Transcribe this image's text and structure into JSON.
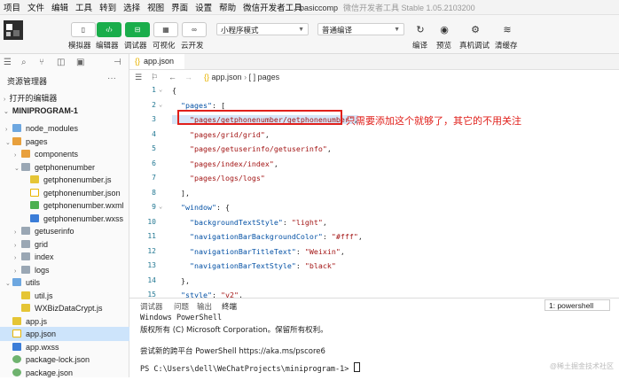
{
  "menubar": {
    "items": [
      "项目",
      "文件",
      "编辑",
      "工具",
      "转到",
      "选择",
      "视图",
      "界面",
      "设置",
      "帮助",
      "微信开发者工具"
    ],
    "project_name": "basiccomp",
    "app_title": "微信开发者工具 Stable 1.05.2103200"
  },
  "toolbar": {
    "simulator": "模拟器",
    "editor": "编辑器",
    "debugger": "调试器",
    "visual": "可视化",
    "cloud": "云开发",
    "mode_select": "小程序模式",
    "compile_select": "普通编译",
    "compile": "编译",
    "preview": "预览",
    "real_debug": "真机调试",
    "clear_cache": "清缓存"
  },
  "sidebar": {
    "resource_manager": "资源管理器",
    "open_editors": "打开的编辑器",
    "root": "MINIPROGRAM-1",
    "tree": [
      {
        "label": "node_modules",
        "depth": 1,
        "kind": "folder-blue",
        "arrow": "›"
      },
      {
        "label": "pages",
        "depth": 1,
        "kind": "folder-orange",
        "arrow": "⌄"
      },
      {
        "label": "components",
        "depth": 2,
        "kind": "folder-orange",
        "arrow": "›"
      },
      {
        "label": "getphonenumber",
        "depth": 2,
        "kind": "folder-gray",
        "arrow": "⌄"
      },
      {
        "label": "getphonenumber.js",
        "depth": 3,
        "kind": "js",
        "arrow": ""
      },
      {
        "label": "getphonenumber.json",
        "depth": 3,
        "kind": "json",
        "arrow": ""
      },
      {
        "label": "getphonenumber.wxml",
        "depth": 3,
        "kind": "wxml",
        "arrow": ""
      },
      {
        "label": "getphonenumber.wxss",
        "depth": 3,
        "kind": "wxss",
        "arrow": ""
      },
      {
        "label": "getuserinfo",
        "depth": 2,
        "kind": "folder-gray",
        "arrow": "›"
      },
      {
        "label": "grid",
        "depth": 2,
        "kind": "folder-gray",
        "arrow": "›"
      },
      {
        "label": "index",
        "depth": 2,
        "kind": "folder-gray",
        "arrow": "›"
      },
      {
        "label": "logs",
        "depth": 2,
        "kind": "folder-gray",
        "arrow": "›"
      },
      {
        "label": "utils",
        "depth": 1,
        "kind": "folder-blue",
        "arrow": "⌄"
      },
      {
        "label": "util.js",
        "depth": 2,
        "kind": "js",
        "arrow": ""
      },
      {
        "label": "WXBizDataCrypt.js",
        "depth": 2,
        "kind": "js",
        "arrow": ""
      },
      {
        "label": "app.js",
        "depth": 1,
        "kind": "js",
        "arrow": ""
      },
      {
        "label": "app.json",
        "depth": 1,
        "kind": "json",
        "arrow": "",
        "selected": true
      },
      {
        "label": "app.wxss",
        "depth": 1,
        "kind": "wxss",
        "arrow": ""
      },
      {
        "label": "package-lock.json",
        "depth": 1,
        "kind": "lock",
        "arrow": ""
      },
      {
        "label": "package.json",
        "depth": 1,
        "kind": "lock",
        "arrow": ""
      }
    ]
  },
  "editor": {
    "tab": "app.json",
    "breadcrumb_file": "app.json",
    "breadcrumb_node": "[ ] pages",
    "lines": [
      {
        "n": "1",
        "fold": "⌄",
        "text": "{"
      },
      {
        "n": "2",
        "fold": "⌄",
        "text": "  \"pages\": ["
      },
      {
        "n": "3",
        "fold": "",
        "text": "    \"pages/getphonenumber/getphonenumber\","
      },
      {
        "n": "4",
        "fold": "",
        "text": "    \"pages/grid/grid\","
      },
      {
        "n": "5",
        "fold": "",
        "text": "    \"pages/getuserinfo/getuserinfo\","
      },
      {
        "n": "6",
        "fold": "",
        "text": "    \"pages/index/index\","
      },
      {
        "n": "7",
        "fold": "",
        "text": "    \"pages/logs/logs\""
      },
      {
        "n": "8",
        "fold": "",
        "text": "  ],"
      },
      {
        "n": "9",
        "fold": "⌄",
        "text": "  \"window\": {"
      },
      {
        "n": "10",
        "fold": "",
        "text": "    \"backgroundTextStyle\": \"light\","
      },
      {
        "n": "11",
        "fold": "",
        "text": "    \"navigationBarBackgroundColor\": \"#fff\","
      },
      {
        "n": "12",
        "fold": "",
        "text": "    \"navigationBarTitleText\": \"Weixin\","
      },
      {
        "n": "13",
        "fold": "",
        "text": "    \"navigationBarTextStyle\": \"black\""
      },
      {
        "n": "14",
        "fold": "",
        "text": "  },"
      },
      {
        "n": "15",
        "fold": "",
        "text": "  \"style\": \"v2\","
      }
    ],
    "annotation": "只需要添加这个就够了，其它的不用关注"
  },
  "panel": {
    "tabs": [
      "调试器",
      "问题",
      "输出",
      "终端"
    ],
    "active_tab": "终端",
    "terminal_select": "1: powershell",
    "terminal_lines": [
      "Windows PowerShell",
      "版权所有 (C) Microsoft Corporation。保留所有权利。",
      "",
      "尝试新的跨平台 PowerShell https://aka.ms/pscore6",
      "",
      "PS C:\\Users\\dell\\WeChatProjects\\miniprogram-1> "
    ]
  },
  "watermark": "@稀土掘金技术社区"
}
